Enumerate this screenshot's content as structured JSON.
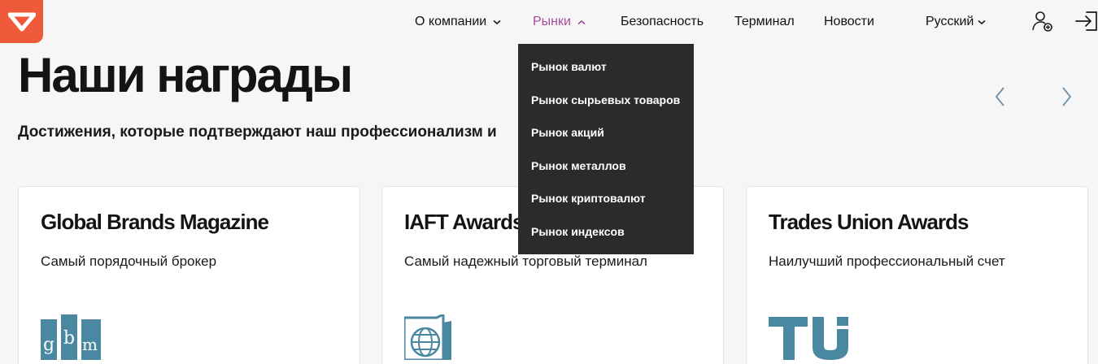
{
  "colors": {
    "brand": "#ee5a3a",
    "accent": "#a74a9a",
    "logo_blue": "#4a87a0",
    "dropdown_bg": "#2b2b2b"
  },
  "header": {
    "logo_icon": "checkmark-logo-icon",
    "nav": [
      {
        "label": "О компании",
        "has_chevron": true,
        "chevron": "chevron-down-icon"
      },
      {
        "label": "Рынки",
        "has_chevron": true,
        "chevron": "chevron-up-icon",
        "active": true
      },
      {
        "label": "Безопасность"
      },
      {
        "label": "Терминал"
      },
      {
        "label": "Новости"
      }
    ],
    "language": "Русский",
    "register_icon": "add-user-icon",
    "login_icon": "sign-in-icon"
  },
  "markets_menu": {
    "items": [
      "Рынок валют",
      "Рынок сырьевых товаров",
      "Рынок акций",
      "Рынок металлов",
      "Рынок криптовалют",
      "Рынок индексов"
    ]
  },
  "section": {
    "title": "Наши награды",
    "subtitle": "Достижения, которые подтверждают наш профессионализм и",
    "prev_icon": "chevron-left-icon",
    "next_icon": "chevron-right-icon"
  },
  "awards": [
    {
      "title": "Global Brands Magazine",
      "description": "Самый порядочный брокер",
      "logo": "gbm-logo",
      "logo_text": "gbm"
    },
    {
      "title": "IAFT Awards",
      "description": "Самый надежный торговый терминал",
      "logo": "iaft-globe-logo"
    },
    {
      "title": "Trades Union Awards",
      "description": "Наилучший профессиональный счет",
      "logo": "tu-logo",
      "logo_text": "TU"
    }
  ]
}
